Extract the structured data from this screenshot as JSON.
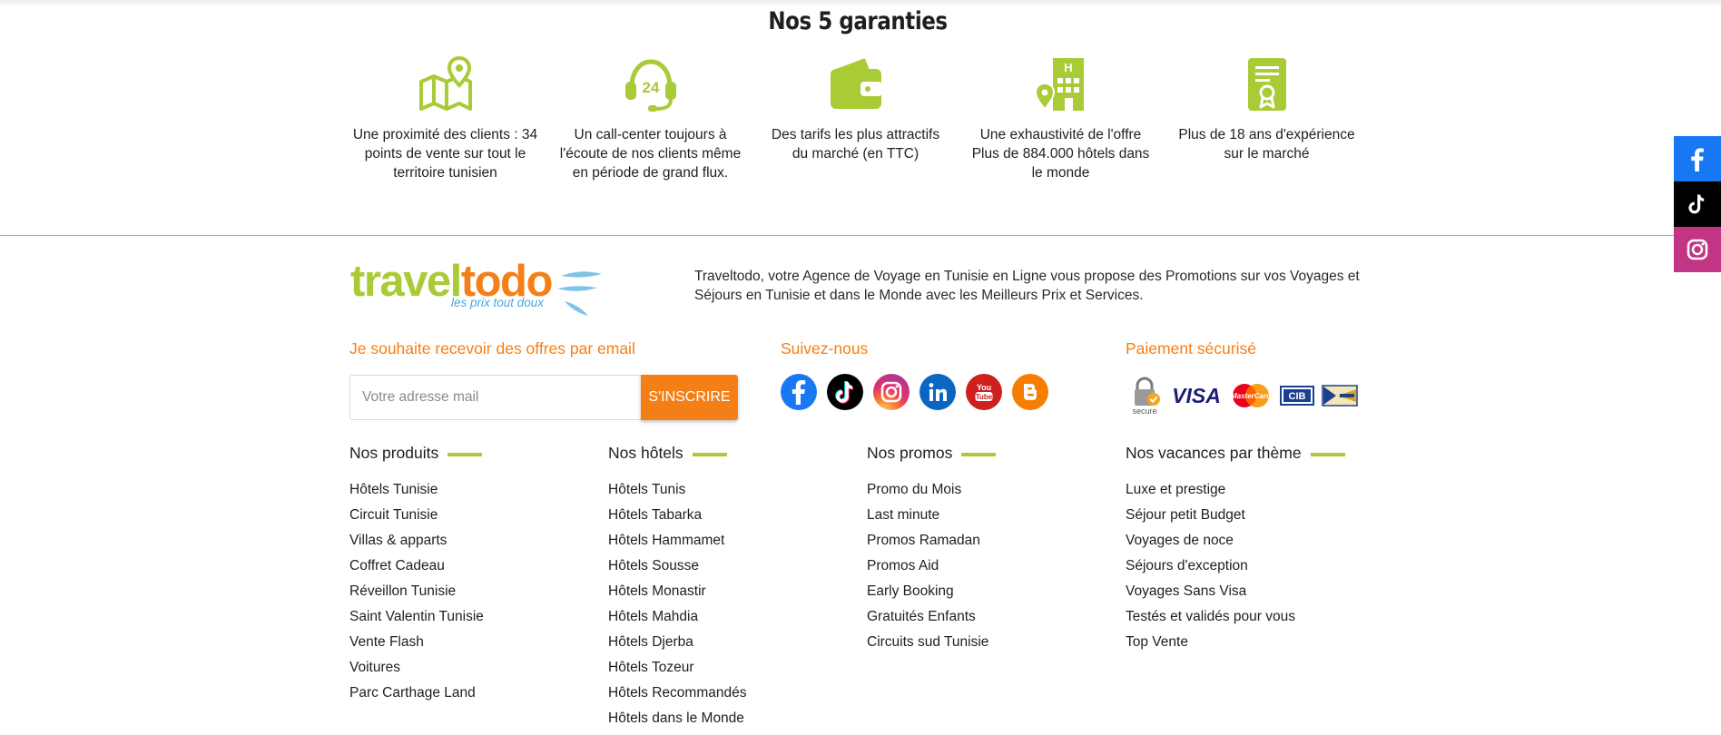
{
  "guarantees": {
    "title": "Nos 5 garanties",
    "items": [
      {
        "icon": "map-pin-icon",
        "text": "Une proximité des clients : 34 points de vente sur tout le territoire tunisien"
      },
      {
        "icon": "headset-24-icon",
        "text": "Un call-center toujours à l'écoute de nos clients même en période de grand flux."
      },
      {
        "icon": "wallet-icon",
        "text": "Des tarifs les plus attractifs du marché (en TTC)"
      },
      {
        "icon": "hotel-building-icon",
        "text": "Une exhaustivité de l'offre Plus de 884.000 hôtels dans le monde"
      },
      {
        "icon": "certificate-icon",
        "text": "Plus de 18 ans d'expérience sur le marché"
      }
    ]
  },
  "brand": {
    "name_part1": "travel",
    "name_part2": "todo",
    "tagline": "les prix tout doux",
    "green": "#a9cb36",
    "orange": "#f57f17"
  },
  "about_text": "Traveltodo, votre Agence de Voyage en Tunisie en Ligne vous propose des Promotions sur vos Voyages et Séjours en Tunisie et dans le Monde avec les Meilleurs Prix et Services.",
  "newsletter": {
    "title": "Je souhaite recevoir des offres par email",
    "placeholder": "Votre adresse mail",
    "button": "S'INSCRIRE"
  },
  "social": {
    "title": "Suivez-nous",
    "networks": [
      "facebook-icon",
      "tiktok-icon",
      "instagram-icon",
      "linkedin-icon",
      "youtube-icon",
      "blogger-icon"
    ],
    "youtube_label_1": "You",
    "youtube_label_2": "Tube"
  },
  "payment": {
    "title": "Paiement sécurisé",
    "secure_label": "secure",
    "visa_label": "VISA",
    "mastercard_label": "MasterCard",
    "cib_label": "CIB"
  },
  "columns": [
    {
      "title": "Nos produits",
      "links": [
        "Hôtels Tunisie",
        "Circuit Tunisie",
        "Villas & apparts",
        "Coffret Cadeau",
        "Réveillon Tunisie",
        "Saint Valentin Tunisie",
        "Vente Flash",
        "Voitures",
        "Parc Carthage Land"
      ]
    },
    {
      "title": "Nos hôtels",
      "links": [
        "Hôtels Tunis",
        "Hôtels Tabarka",
        "Hôtels Hammamet",
        "Hôtels Sousse",
        "Hôtels Monastir",
        "Hôtels Mahdia",
        "Hôtels Djerba",
        "Hôtels Tozeur",
        "Hôtels Recommandés",
        "Hôtels dans le Monde"
      ]
    },
    {
      "title": "Nos promos",
      "links": [
        "Promo du Mois",
        "Last minute",
        "Promos Ramadan",
        "Promos Aid",
        "Early Booking",
        "Gratuités Enfants",
        "Circuits sud Tunisie"
      ]
    },
    {
      "title": "Nos vacances par thème",
      "links": [
        "Luxe et prestige",
        "Séjour petit Budget",
        "Voyages de noce",
        "Séjours d'exception",
        "Voyages Sans Visa",
        "Testés et validés pour vous",
        "Top Vente"
      ]
    }
  ],
  "side_social": [
    "facebook-icon",
    "tiktok-icon",
    "instagram-icon"
  ]
}
